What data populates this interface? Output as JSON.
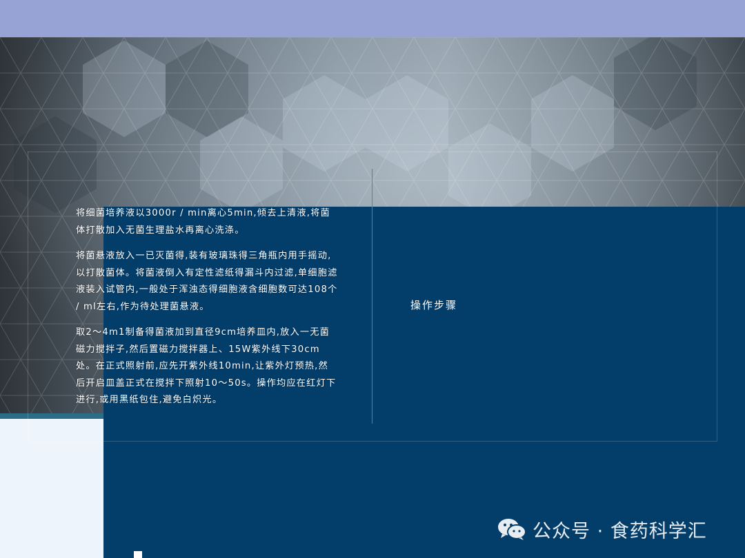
{
  "content": {
    "paragraphs": [
      "将细菌培养液以3000r / min离心5min,倾去上清液,将菌体打散加入无菌生理盐水再离心洗涤。",
      "将菌悬液放入一已灭菌得,装有玻璃珠得三角瓶内用手摇动,以打散菌体。将菌液倒入有定性滤纸得漏斗内过滤,单细胞滤液装入试管内,一般处于浑浊态得细胞液含细胞数可达108个 / ml左右,作为待处理菌悬液。",
      "取2～4m1制备得菌液加到直径9cm培养皿内,放入一无菌磁力搅拌子,然后置磁力搅拌器上、15W紫外线下30cm处。在正式照射前,应先开紫外线10min,让紫外灯预热,然后开启皿盖正式在搅拌下照射10～50s。操作均应在红灯下进行,或用黑纸包住,避免白炽光。"
    ],
    "section_title": "操作步骤"
  },
  "watermark": {
    "text": "公众号 · 食药科学汇",
    "icon": "wechat-icon"
  },
  "colors": {
    "top_band": "#96a3d4",
    "panel_blue": "#033d6a",
    "accent_teal": "#2b6d86"
  }
}
